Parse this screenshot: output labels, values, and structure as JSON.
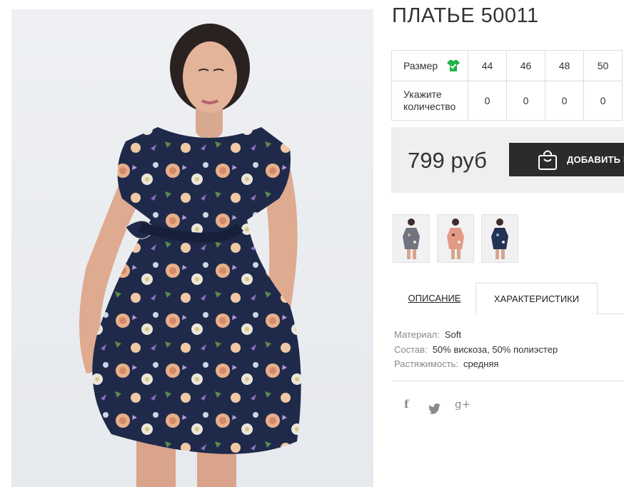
{
  "product": {
    "title": "ПЛАТЬЕ 50011",
    "image_alt": "floral-dress-photo"
  },
  "size_table": {
    "size_label": "Размер",
    "qty_label_line1": "Укажите",
    "qty_label_line2": "количество",
    "sizes": [
      "44",
      "46",
      "48",
      "50"
    ],
    "quantities": [
      "0",
      "0",
      "0",
      "0"
    ],
    "icon": "shirt-check-icon",
    "icon_color": "#1fb24a"
  },
  "purchase": {
    "price": "799 руб",
    "add_button_label": "ДОБАВИТЬ В",
    "bag_icon": "shopping-bag-icon"
  },
  "thumbnails": [
    {
      "name": "thumb-grey-floral",
      "color": "#6f7480"
    },
    {
      "name": "thumb-peach-floral",
      "color": "#e29a86"
    },
    {
      "name": "thumb-navy-floral",
      "color": "#233356"
    }
  ],
  "tabs": {
    "description": "ОПИСАНИЕ",
    "characteristics": "ХАРАКТЕРИСТИКИ",
    "active": "characteristics"
  },
  "specs": {
    "material_label": "Материал:",
    "material_value": "Soft",
    "composition_label": "Состав:",
    "composition_value": "50% вискоза, 50% полиэстер",
    "stretch_label": "Растяжимость:",
    "stretch_value": "средняя"
  },
  "social": {
    "facebook": "f",
    "google": "g+",
    "icons": [
      "facebook-icon",
      "twitter-icon",
      "google-plus-icon"
    ]
  },
  "colors": {
    "dress_navy": "#1f2a4a",
    "button_dark": "#2b2b2b",
    "price_bg": "#efefef",
    "accent_green": "#1fb24a"
  }
}
